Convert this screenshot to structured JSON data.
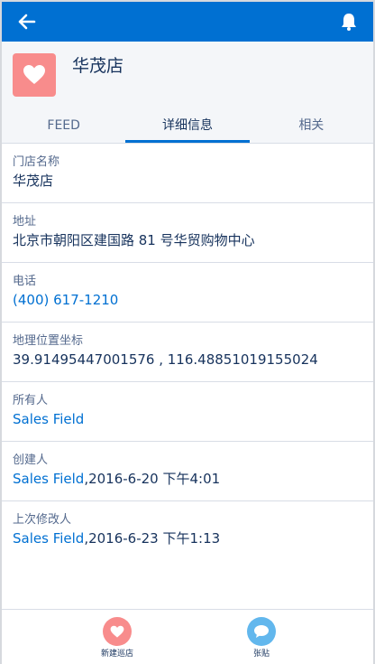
{
  "topbar": {
    "back_icon": "arrow-left-icon",
    "bell_icon": "bell-icon",
    "accent_color": "#0070d2"
  },
  "record": {
    "icon": "heart-icon",
    "icon_color": "#f88c8c",
    "title": "华茂店"
  },
  "tabs": [
    {
      "label": "FEED"
    },
    {
      "label": "详细信息",
      "active": true
    },
    {
      "label": "相关"
    }
  ],
  "fields": [
    {
      "label": "门店名称",
      "value": "华茂店"
    },
    {
      "label": "地址",
      "value": "北京市朝阳区建国路 81 号华贸购物中心"
    },
    {
      "label": "电话",
      "value": "(400) 617-1210"
    },
    {
      "label": "地理位置坐标",
      "value": "39.91495447001576 , 116.48851019155024"
    },
    {
      "label": "所有人",
      "value": "Sales Field"
    },
    {
      "label": "创建人",
      "link": "Sales Field",
      "value": ",2016-6-20 下午4:01"
    },
    {
      "label": "上次修改人",
      "link": "Sales Field",
      "value": ",2016-6-23 下午1:13"
    }
  ],
  "footer": {
    "actions": [
      {
        "label": "新建巡店",
        "icon": "heart-icon",
        "color": "#f88c8c"
      },
      {
        "label": "张贴",
        "icon": "chat-bubble-icon",
        "color": "#62b7ed"
      }
    ]
  }
}
